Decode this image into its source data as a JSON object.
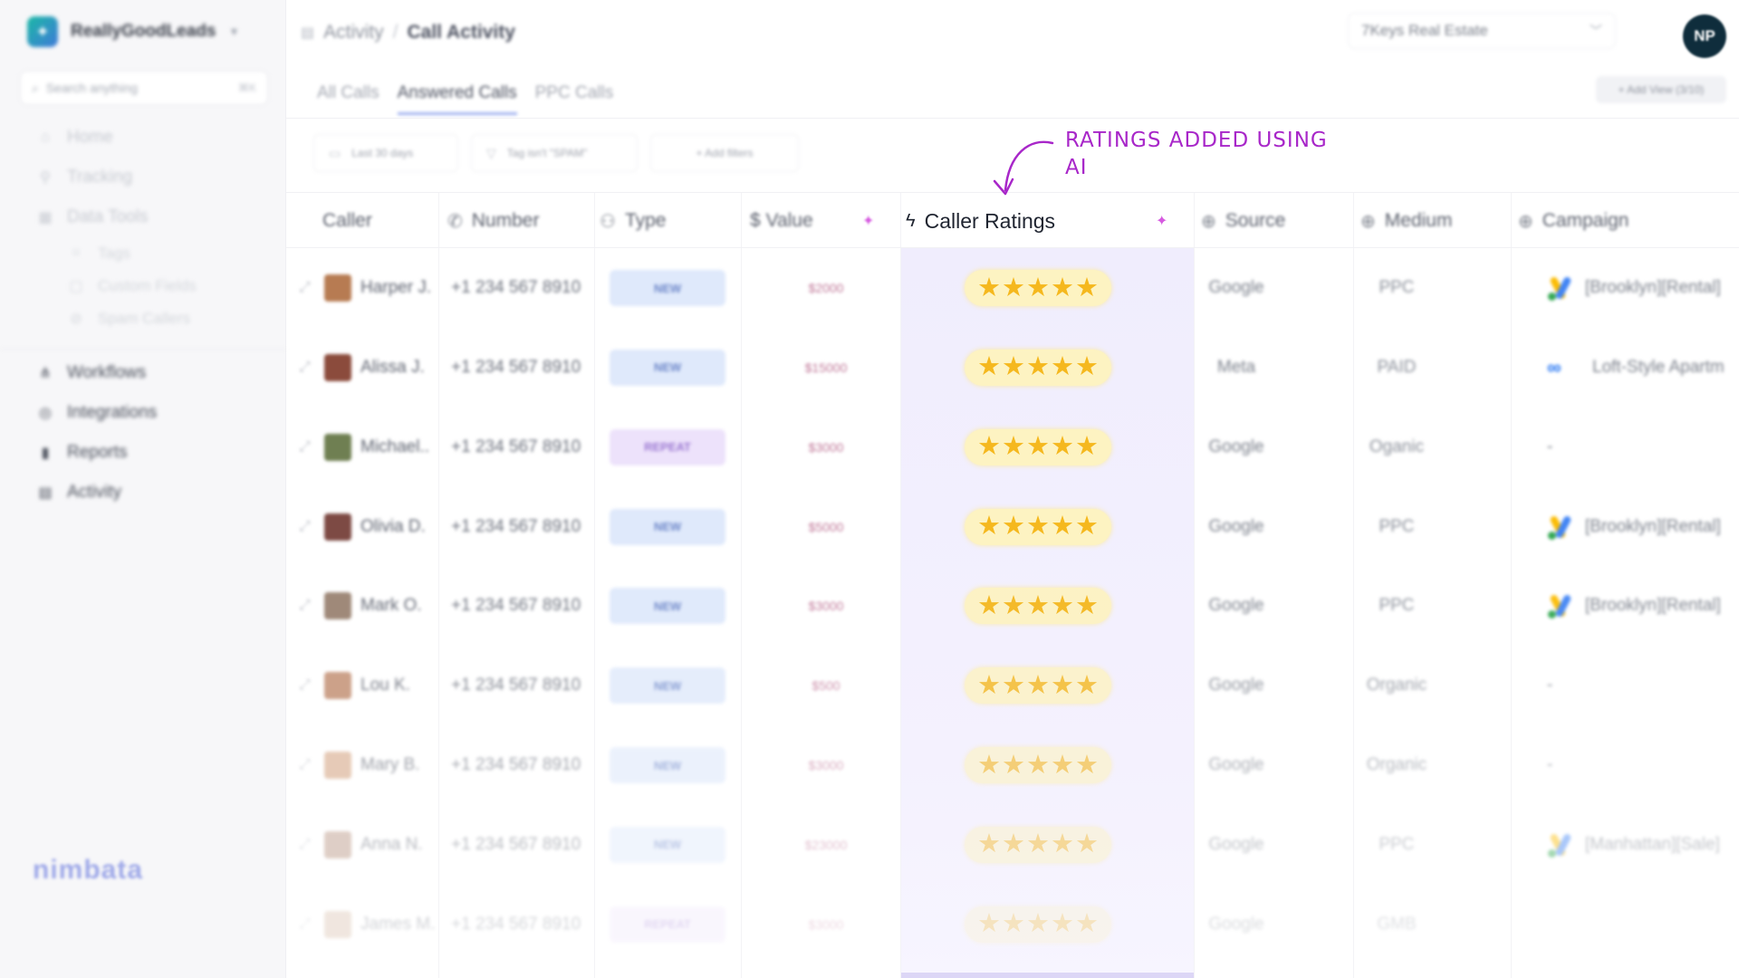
{
  "app": {
    "brand_name": "ReallyGoodLeads",
    "search_placeholder": "Search anything",
    "search_shortcut": "⌘K",
    "footer_logo": "nimbata"
  },
  "sidebar": {
    "top_items": [
      {
        "label": "Home",
        "icon": "home-icon"
      },
      {
        "label": "Tracking",
        "icon": "pin-icon"
      },
      {
        "label": "Data Tools",
        "icon": "grid-icon"
      }
    ],
    "data_tools_sub": [
      {
        "label": "Tags",
        "icon": "tag-icon"
      },
      {
        "label": "Custom Fields",
        "icon": "field-icon"
      },
      {
        "label": "Spam Callers",
        "icon": "spam-icon"
      }
    ],
    "bottom_items": [
      {
        "label": "Workflows",
        "icon": "workflow-icon"
      },
      {
        "label": "Integrations",
        "icon": "integration-icon"
      },
      {
        "label": "Reports",
        "icon": "chart-icon"
      },
      {
        "label": "Activity",
        "icon": "activity-icon"
      }
    ]
  },
  "header": {
    "breadcrumb_parent": "Activity",
    "breadcrumb_sep": "/",
    "breadcrumb_current": "Call Activity",
    "account": "7Keys Real Estate",
    "avatar_initials": "NP"
  },
  "tabs": [
    {
      "label": "All Calls",
      "active": false
    },
    {
      "label": "Answered Calls",
      "active": true
    },
    {
      "label": "PPC Calls",
      "active": false
    }
  ],
  "add_view": "+ Add View (3/10)",
  "filters": {
    "date": "Last 30 days",
    "tag": "Tag isn't \"SPAM\"",
    "add": "+ Add filters"
  },
  "columns": {
    "caller": "Caller",
    "number": "Number",
    "type": "Type",
    "value": "$ Value",
    "ratings": "Caller Ratings",
    "source": "Source",
    "medium": "Medium",
    "campaign": "Campaign"
  },
  "annotation": "RATINGS ADDED USING AI",
  "rows": [
    {
      "caller": "Harper J.",
      "number": "+1 234 567 8910",
      "type": "NEW",
      "type_kind": "new",
      "value": "$2000",
      "rating": 5,
      "source": "Google",
      "medium": "PPC",
      "campaign": "[Brooklyn][Rental]",
      "campaign_icon": "google-ads-icon",
      "face": "#b77b52",
      "opacity": 1
    },
    {
      "caller": "Alissa J.",
      "number": "+1 234 567 8910",
      "type": "NEW",
      "type_kind": "new",
      "value": "$15000",
      "rating": 5,
      "source": "Meta",
      "medium": "PAID",
      "campaign": "Loft-Style Apartm",
      "campaign_icon": "meta-icon",
      "face": "#8b4b3c",
      "opacity": 1
    },
    {
      "caller": "Michael..",
      "number": "+1 234 567 8910",
      "type": "REPEAT",
      "type_kind": "repeat",
      "value": "$3000",
      "rating": 5,
      "source": "Google",
      "medium": "Oganic",
      "campaign": "-",
      "campaign_icon": "",
      "face": "#6f7f52",
      "opacity": 1
    },
    {
      "caller": "Olivia D.",
      "number": "+1 234 567 8910",
      "type": "NEW",
      "type_kind": "new",
      "value": "$5000",
      "rating": 5,
      "source": "Google",
      "medium": "PPC",
      "campaign": "[Brooklyn][Rental]",
      "campaign_icon": "google-ads-icon",
      "face": "#7d4a44",
      "opacity": 1
    },
    {
      "caller": "Mark O.",
      "number": "+1 234 567 8910",
      "type": "NEW",
      "type_kind": "new",
      "value": "$3000",
      "rating": 5,
      "source": "Google",
      "medium": "PPC",
      "campaign": "[Brooklyn][Rental]",
      "campaign_icon": "google-ads-icon",
      "face": "#9a8372",
      "opacity": 0.95
    },
    {
      "caller": "Lou K.",
      "number": "+1 234 567 8910",
      "type": "NEW",
      "type_kind": "new",
      "value": "$500",
      "rating": 5,
      "source": "Google",
      "medium": "Organic",
      "campaign": "-",
      "campaign_icon": "",
      "face": "#c08a6c",
      "opacity": 0.8
    },
    {
      "caller": "Mary B.",
      "number": "+1 234 567 8910",
      "type": "NEW",
      "type_kind": "new",
      "value": "$3000",
      "rating": 5,
      "source": "Google",
      "medium": "Organic",
      "campaign": "-",
      "campaign_icon": "",
      "face": "#d6a888",
      "opacity": 0.6
    },
    {
      "caller": "Anna N.",
      "number": "+1 234 567 8910",
      "type": "NEW",
      "type_kind": "new",
      "value": "$23000",
      "rating": 5,
      "source": "Google",
      "medium": "PPC",
      "campaign": "[Manhattan][Sale]",
      "campaign_icon": "google-ads-icon",
      "face": "#b89482",
      "opacity": 0.45
    },
    {
      "caller": "James M.",
      "number": "+1 234 567 8910",
      "type": "REPEAT",
      "type_kind": "repeat",
      "value": "$3000",
      "rating": 5,
      "source": "Google",
      "medium": "GMB",
      "campaign": "",
      "campaign_icon": "",
      "face": "#caa98e",
      "opacity": 0.28
    }
  ],
  "colors": {
    "accent": "#9fb0ef",
    "rating_bg": "#f0edfd",
    "star": "#f5b81e",
    "annotation": "#a827c9"
  }
}
